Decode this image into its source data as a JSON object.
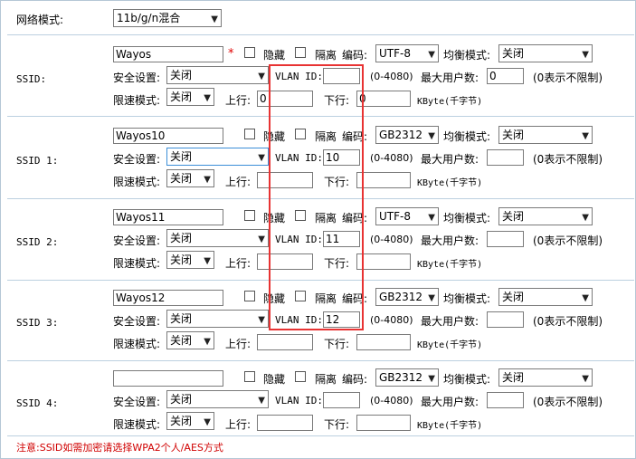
{
  "mode": {
    "label": "网络模式:",
    "value": "11b/g/n混合"
  },
  "labels": {
    "hide": "隐藏",
    "isolate": "隔离",
    "encoding": "编码:",
    "balance": "均衡模式:",
    "security": "安全设置:",
    "vlan": "VLAN ID:",
    "vlan_range": "(0-4080)",
    "max_users": "最大用户数:",
    "no_limit": "(0表示不限制)",
    "rate_mode": "限速模式:",
    "upload": "上行:",
    "download": "下行:",
    "unit": "KByte(千字节)",
    "required": "*"
  },
  "ssids": [
    {
      "label": "SSID:",
      "name": "Wayos",
      "encoding": "UTF-8",
      "balance": "关闭",
      "security": "关闭",
      "vlan": "",
      "max_users": "0",
      "rate_mode": "关闭",
      "upload": "0",
      "download": "0"
    },
    {
      "label": "SSID 1:",
      "name": "Wayos10",
      "encoding": "GB2312",
      "balance": "关闭",
      "security": "关闭",
      "vlan": "10",
      "max_users": "",
      "rate_mode": "关闭",
      "upload": "",
      "download": ""
    },
    {
      "label": "SSID 2:",
      "name": "Wayos11",
      "encoding": "UTF-8",
      "balance": "关闭",
      "security": "关闭",
      "vlan": "11",
      "max_users": "",
      "rate_mode": "关闭",
      "upload": "",
      "download": ""
    },
    {
      "label": "SSID 3:",
      "name": "Wayos12",
      "encoding": "GB2312",
      "balance": "关闭",
      "security": "关闭",
      "vlan": "12",
      "max_users": "",
      "rate_mode": "关闭",
      "upload": "",
      "download": ""
    },
    {
      "label": "SSID 4:",
      "name": "",
      "encoding": "GB2312",
      "balance": "关闭",
      "security": "关闭",
      "vlan": "",
      "max_users": "",
      "rate_mode": "关闭",
      "upload": "",
      "download": ""
    }
  ],
  "note": "注意:SSID如需加密请选择WPA2个人/AES方式",
  "colors": {
    "highlight": "#e83333",
    "note": "#d00000",
    "divider": "#bcd0e0"
  }
}
